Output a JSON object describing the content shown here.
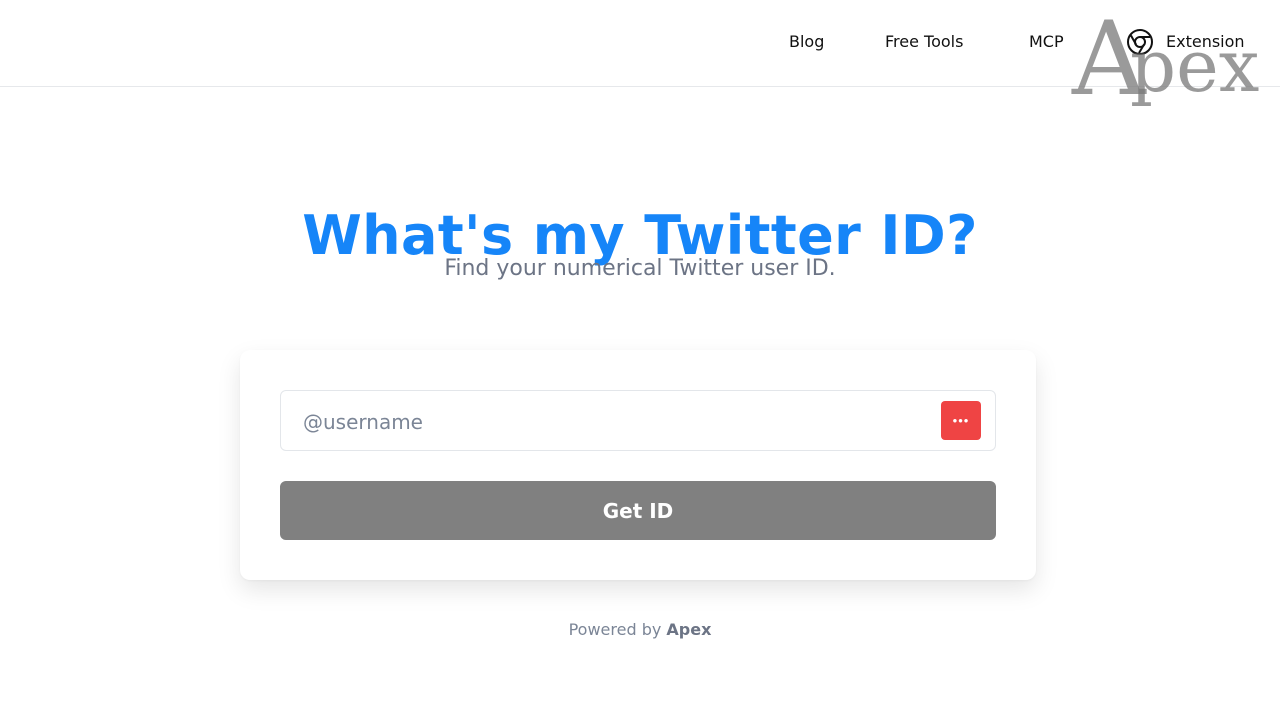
{
  "header": {
    "nav": [
      {
        "label": "Blog"
      },
      {
        "label": "Free Tools"
      },
      {
        "label": "MCP"
      },
      {
        "label": "Extension",
        "icon": "chrome-icon"
      }
    ],
    "watermark": {
      "text": "Apex"
    }
  },
  "hero": {
    "title": "What's my Twitter ID?",
    "subtitle": "Find your numerical Twitter user ID.",
    "accent_color": "#1685f8"
  },
  "form": {
    "input": {
      "placeholder": "@username",
      "value": ""
    },
    "options_button": {
      "icon": "more-dots-icon",
      "label": "•••",
      "color": "#ef4444"
    },
    "submit": {
      "label": "Get ID",
      "color": "#808080"
    }
  },
  "footer": {
    "prefix": "Powered by",
    "brand": "Apex"
  }
}
